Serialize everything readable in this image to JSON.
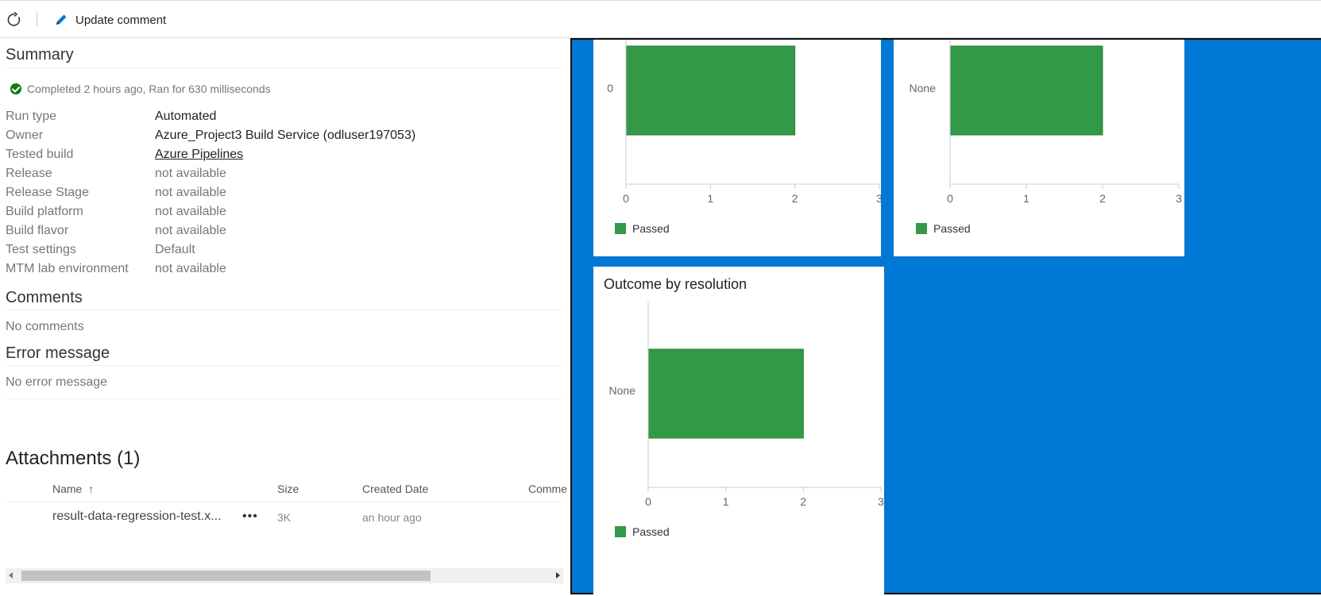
{
  "toolbar": {
    "update_label": "Update comment"
  },
  "summary": {
    "title": "Summary",
    "status": "Completed 2 hours ago, Ran for 630 milliseconds",
    "fields": [
      {
        "label": "Run type",
        "value": "Automated"
      },
      {
        "label": "Owner",
        "value": "Azure_Project3 Build Service (odluser197053)"
      },
      {
        "label": "Tested build",
        "value": "Azure Pipelines"
      },
      {
        "label": "Release",
        "value": "not available"
      },
      {
        "label": "Release Stage",
        "value": "not available"
      },
      {
        "label": "Build platform",
        "value": "not available"
      },
      {
        "label": "Build flavor",
        "value": "not available"
      },
      {
        "label": "Test settings",
        "value": "Default"
      },
      {
        "label": "MTM lab environment",
        "value": "not available"
      }
    ]
  },
  "comments": {
    "title": "Comments",
    "text": "No comments"
  },
  "error": {
    "title": "Error message",
    "text": "No error message"
  },
  "attachments": {
    "title": "Attachments (1)",
    "columns": [
      "Name",
      "Size",
      "Created Date",
      "Comme"
    ],
    "sort_icon": "↑",
    "rows": [
      {
        "name": "result-data-regression-test.x...",
        "more": "•••",
        "size": "3K",
        "created": "an hour ago"
      }
    ]
  },
  "colors": {
    "overlay_bg": "#0078d4",
    "bar": "#339947",
    "status_ok": "#107c10"
  },
  "chart_data": [
    {
      "type": "bar",
      "orientation": "horizontal",
      "title": "",
      "categories": [
        "0"
      ],
      "series": [
        {
          "name": "Passed",
          "values": [
            2
          ]
        }
      ],
      "xlim": [
        0,
        3
      ],
      "xticks": [
        "0",
        "1",
        "2",
        "3"
      ],
      "legend": "bottom-left"
    },
    {
      "type": "bar",
      "orientation": "horizontal",
      "title": "",
      "categories": [
        "None"
      ],
      "series": [
        {
          "name": "Passed",
          "values": [
            2
          ]
        }
      ],
      "xlim": [
        0,
        3
      ],
      "xticks": [
        "0",
        "1",
        "2",
        "3"
      ],
      "legend": "bottom-left"
    },
    {
      "type": "bar",
      "orientation": "horizontal",
      "title": "Outcome by resolution",
      "categories": [
        "None"
      ],
      "series": [
        {
          "name": "Passed",
          "values": [
            2
          ]
        }
      ],
      "xlim": [
        0,
        3
      ],
      "xticks": [
        "0",
        "1",
        "2",
        "3"
      ],
      "legend": "bottom-left"
    }
  ]
}
